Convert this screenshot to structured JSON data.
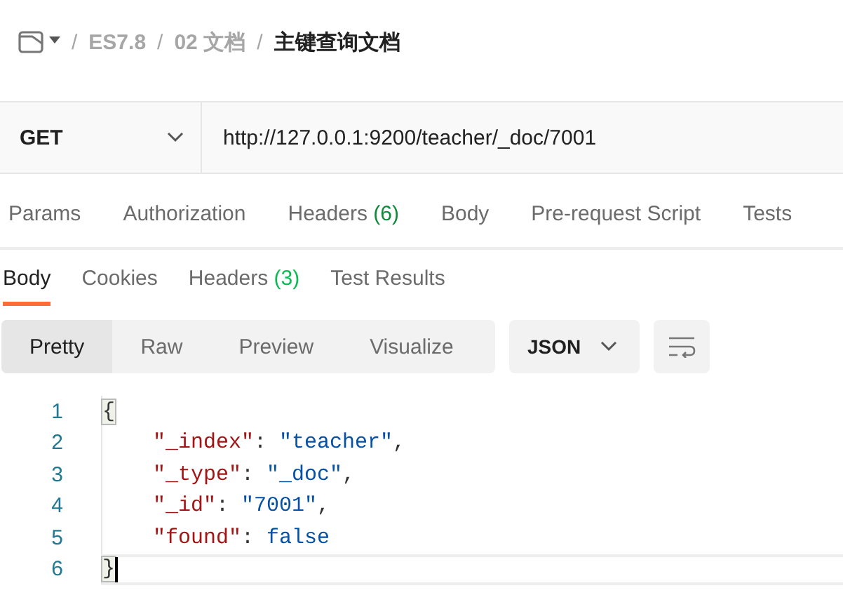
{
  "breadcrumb": [
    {
      "separator": "/",
      "label": "ES7.8",
      "current": false
    },
    {
      "separator": "/",
      "label": "02 文档",
      "current": false
    },
    {
      "separator": "/",
      "label": "主键查询文档",
      "current": true
    }
  ],
  "request": {
    "method": "GET",
    "url": "http://127.0.0.1:9200/teacher/_doc/7001"
  },
  "request_tabs": [
    {
      "label": "Params",
      "selected": false
    },
    {
      "label": "Authorization",
      "selected": false
    },
    {
      "label": "Headers",
      "count": "(6)",
      "selected": false
    },
    {
      "label": "Body",
      "selected": false
    },
    {
      "label": "Pre-request Script",
      "selected": false
    },
    {
      "label": "Tests",
      "selected": false
    }
  ],
  "response_tabs": [
    {
      "label": "Body",
      "selected": true
    },
    {
      "label": "Cookies",
      "selected": false
    },
    {
      "label": "Headers",
      "count": "(3)",
      "selected": false
    },
    {
      "label": "Test Results",
      "selected": false
    }
  ],
  "view_modes": [
    {
      "label": "Pretty",
      "selected": true
    },
    {
      "label": "Raw",
      "selected": false
    },
    {
      "label": "Preview",
      "selected": false
    },
    {
      "label": "Visualize",
      "selected": false
    }
  ],
  "format": "JSON",
  "code_lines": [
    {
      "number": "1",
      "current": false,
      "tokens": [
        {
          "kind": "bracket",
          "text": "{"
        }
      ]
    },
    {
      "number": "2",
      "current": false,
      "indented": true,
      "tokens": [
        {
          "kind": "key",
          "text": "\"_index\""
        },
        {
          "kind": "punct",
          "text": ": "
        },
        {
          "kind": "string",
          "text": "\"teacher\""
        },
        {
          "kind": "punct",
          "text": ","
        }
      ]
    },
    {
      "number": "3",
      "current": false,
      "indented": true,
      "tokens": [
        {
          "kind": "key",
          "text": "\"_type\""
        },
        {
          "kind": "punct",
          "text": ": "
        },
        {
          "kind": "string",
          "text": "\"_doc\""
        },
        {
          "kind": "punct",
          "text": ","
        }
      ]
    },
    {
      "number": "4",
      "current": false,
      "indented": true,
      "tokens": [
        {
          "kind": "key",
          "text": "\"_id\""
        },
        {
          "kind": "punct",
          "text": ": "
        },
        {
          "kind": "string",
          "text": "\"7001\""
        },
        {
          "kind": "punct",
          "text": ","
        }
      ]
    },
    {
      "number": "5",
      "current": false,
      "indented": true,
      "tokens": [
        {
          "kind": "key",
          "text": "\"found\""
        },
        {
          "kind": "punct",
          "text": ": "
        },
        {
          "kind": "bool",
          "text": "false"
        }
      ]
    },
    {
      "number": "6",
      "current": true,
      "tokens": [
        {
          "kind": "bracket",
          "text": "}"
        }
      ]
    }
  ]
}
